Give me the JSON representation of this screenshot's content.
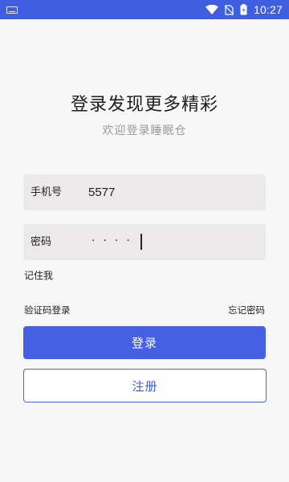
{
  "status_bar": {
    "time": "10:27",
    "icons": [
      "keyboard-icon",
      "wifi-icon",
      "no-sim-icon",
      "battery-icon"
    ]
  },
  "header": {
    "title": "登录发现更多精彩",
    "subtitle": "欢迎登录睡眠仓"
  },
  "form": {
    "phone_label": "手机号",
    "phone_value": "5577",
    "password_label": "密码",
    "password_mask": "····",
    "remember_label": "记住我",
    "sms_login_label": "验证码登录",
    "forgot_label": "忘记密码"
  },
  "buttons": {
    "login_label": "登录",
    "register_label": "注册"
  },
  "colors": {
    "accent": "#4560e2",
    "status_bar": "#3f5fe0",
    "field_bg": "#ebe9e9",
    "page_bg": "#f7f7f7"
  }
}
